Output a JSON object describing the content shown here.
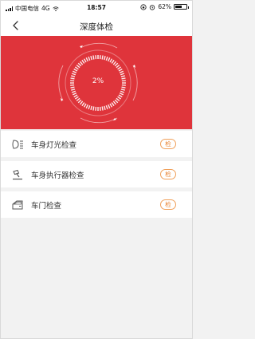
{
  "status_bar": {
    "carrier": "中国电信",
    "network": "4G",
    "time": "18:57",
    "battery": "62%",
    "battery_level": 0.62
  },
  "nav": {
    "title": "深度体检",
    "back_icon": "chevron-left-icon"
  },
  "hero": {
    "progress_text": "2%",
    "progress_value": 0.02,
    "background": "#df343b"
  },
  "checks": [
    {
      "label": "车身灯光检查",
      "badge": "检",
      "icon": "headlight-icon"
    },
    {
      "label": "车身执行器检查",
      "badge": "检",
      "icon": "actuator-icon"
    },
    {
      "label": "车门检查",
      "badge": "检",
      "icon": "car-door-icon"
    }
  ],
  "colors": {
    "accent": "#df343b",
    "badge": "#e8812e",
    "page_background": "#f2f2f2"
  }
}
